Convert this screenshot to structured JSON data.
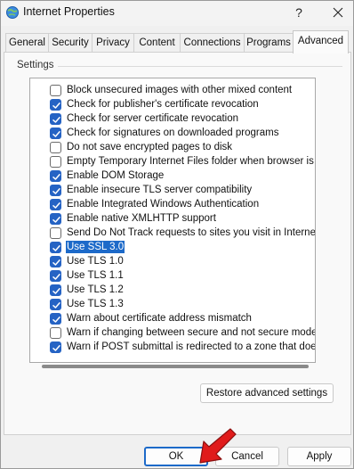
{
  "window": {
    "title": "Internet Properties",
    "help_glyph": "?",
    "close_icon": "close-icon",
    "app_icon": "internet-globe-icon"
  },
  "tabs": [
    {
      "label": "General",
      "active": false
    },
    {
      "label": "Security",
      "active": false
    },
    {
      "label": "Privacy",
      "active": false
    },
    {
      "label": "Content",
      "active": false
    },
    {
      "label": "Connections",
      "active": false
    },
    {
      "label": "Programs",
      "active": false
    },
    {
      "label": "Advanced",
      "active": true
    }
  ],
  "settings": {
    "group_label": "Settings",
    "items": [
      {
        "label": "Block unsecured images with other mixed content",
        "checked": false,
        "selected": false
      },
      {
        "label": "Check for publisher's certificate revocation",
        "checked": true,
        "selected": false
      },
      {
        "label": "Check for server certificate revocation",
        "checked": true,
        "selected": false
      },
      {
        "label": "Check for signatures on downloaded programs",
        "checked": true,
        "selected": false
      },
      {
        "label": "Do not save encrypted pages to disk",
        "checked": false,
        "selected": false
      },
      {
        "label": "Empty Temporary Internet Files folder when browser is clo",
        "checked": false,
        "selected": false
      },
      {
        "label": "Enable DOM Storage",
        "checked": true,
        "selected": false
      },
      {
        "label": "Enable insecure TLS server compatibility",
        "checked": true,
        "selected": false
      },
      {
        "label": "Enable Integrated Windows Authentication",
        "checked": true,
        "selected": false
      },
      {
        "label": "Enable native XMLHTTP support",
        "checked": true,
        "selected": false
      },
      {
        "label": "Send Do Not Track requests to sites you visit in Internet E",
        "checked": false,
        "selected": false
      },
      {
        "label": "Use SSL 3.0",
        "checked": true,
        "selected": true
      },
      {
        "label": "Use TLS 1.0",
        "checked": true,
        "selected": false
      },
      {
        "label": "Use TLS 1.1",
        "checked": true,
        "selected": false
      },
      {
        "label": "Use TLS 1.2",
        "checked": true,
        "selected": false
      },
      {
        "label": "Use TLS 1.3",
        "checked": true,
        "selected": false
      },
      {
        "label": "Warn about certificate address mismatch",
        "checked": true,
        "selected": false
      },
      {
        "label": "Warn if changing between secure and not secure mode",
        "checked": false,
        "selected": false
      },
      {
        "label": "Warn if POST submittal is redirected to a zone that does n",
        "checked": true,
        "selected": false
      }
    ],
    "restore_label": "Restore advanced settings"
  },
  "buttons": {
    "ok": "OK",
    "cancel": "Cancel",
    "apply": "Apply"
  },
  "colors": {
    "accent": "#1d6ac9",
    "checkbox": "#2563c4",
    "annotation_arrow": "#e01b1b"
  }
}
